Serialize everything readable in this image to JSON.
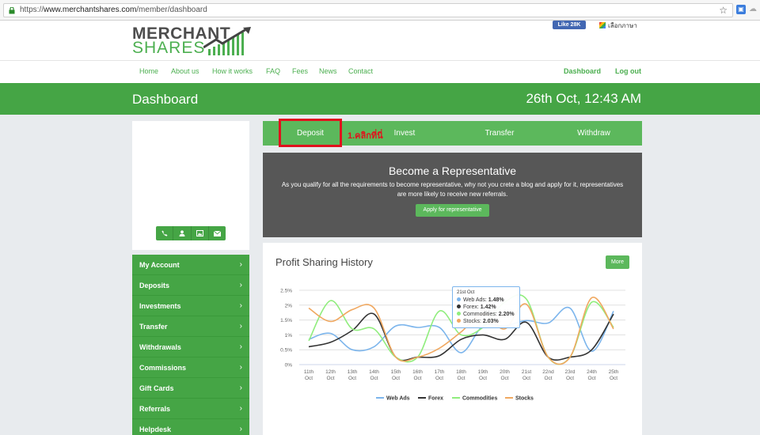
{
  "browser": {
    "url_prefix": "https://",
    "url_host": "www.merchantshares.com",
    "url_path": "/member/dashboard"
  },
  "header": {
    "logo_line1": "MERCHANT",
    "logo_line2": "SHARES",
    "fb_like": "Like 28K",
    "language": "เลือกภาษา",
    "nav": [
      "Home",
      "About us",
      "How it works",
      "FAQ",
      "Fees",
      "News",
      "Contact"
    ],
    "nav_right": [
      "Dashboard",
      "Log out"
    ]
  },
  "title_band": {
    "title": "Dashboard",
    "datetime": "26th Oct, 12:43 AM"
  },
  "sidebar": {
    "items": [
      "My Account",
      "Deposits",
      "Investments",
      "Transfer",
      "Withdrawals",
      "Commissions",
      "Gift Cards",
      "Referrals",
      "Helpdesk"
    ],
    "chevron": "›"
  },
  "tabs": [
    "Deposit",
    "Invest",
    "Transfer",
    "Withdraw"
  ],
  "annotation": "1.คลิกที่นี่",
  "representative": {
    "title": "Become a Representative",
    "text": "As you qualify for all the requirements to become representative, why not you crete a blog and apply for it, representatives are more likely to receive new referrals.",
    "button": "Apply for representative"
  },
  "profit": {
    "title": "Profit Sharing History",
    "more": "More"
  },
  "tooltip": {
    "date": "21st Oct",
    "rows": [
      {
        "label": "Web Ads:",
        "value": "1.48%"
      },
      {
        "label": "Forex:",
        "value": "1.42%"
      },
      {
        "label": "Commodities:",
        "value": "2.20%"
      },
      {
        "label": "Stocks:",
        "value": "2.03%"
      }
    ]
  },
  "colors": {
    "green": "#45a545",
    "web_ads": "#7cb5ec",
    "forex": "#333333",
    "commodities": "#90ed7d",
    "stocks": "#f0a860",
    "highlight": "#e0131d"
  },
  "chart_data": {
    "type": "line",
    "categories": [
      "11th Oct",
      "12th Oct",
      "13th Oct",
      "14th Oct",
      "15th Oct",
      "16th Oct",
      "17th Oct",
      "18th Oct",
      "19th Oct",
      "20th Oct",
      "21st Oct",
      "22nd Oct",
      "23rd Oct",
      "24th Oct",
      "25th Oct"
    ],
    "ylim": [
      0,
      2.5
    ],
    "yticks": [
      "0%",
      "0.5%",
      "1%",
      "1.5%",
      "2%",
      "2.5%"
    ],
    "legend_position": "bottom",
    "series": [
      {
        "name": "Web Ads",
        "values": [
          0.85,
          1.05,
          0.5,
          0.6,
          1.3,
          1.25,
          1.25,
          0.4,
          1.3,
          1.3,
          1.48,
          1.4,
          1.9,
          0.45,
          1.8
        ]
      },
      {
        "name": "Forex",
        "values": [
          0.6,
          0.75,
          1.15,
          1.7,
          0.25,
          0.25,
          0.3,
          0.85,
          1.0,
          0.85,
          1.42,
          0.25,
          0.25,
          0.5,
          1.7
        ]
      },
      {
        "name": "Commodities",
        "values": [
          0.8,
          2.15,
          1.2,
          1.2,
          0.25,
          0.25,
          1.8,
          1.0,
          1.25,
          2.1,
          2.2,
          0.25,
          0.25,
          2.1,
          1.25
        ]
      },
      {
        "name": "Stocks",
        "values": [
          1.9,
          1.45,
          1.85,
          1.9,
          0.25,
          0.25,
          0.55,
          1.1,
          1.7,
          1.2,
          2.03,
          0.25,
          0.25,
          2.25,
          1.2
        ]
      }
    ]
  }
}
